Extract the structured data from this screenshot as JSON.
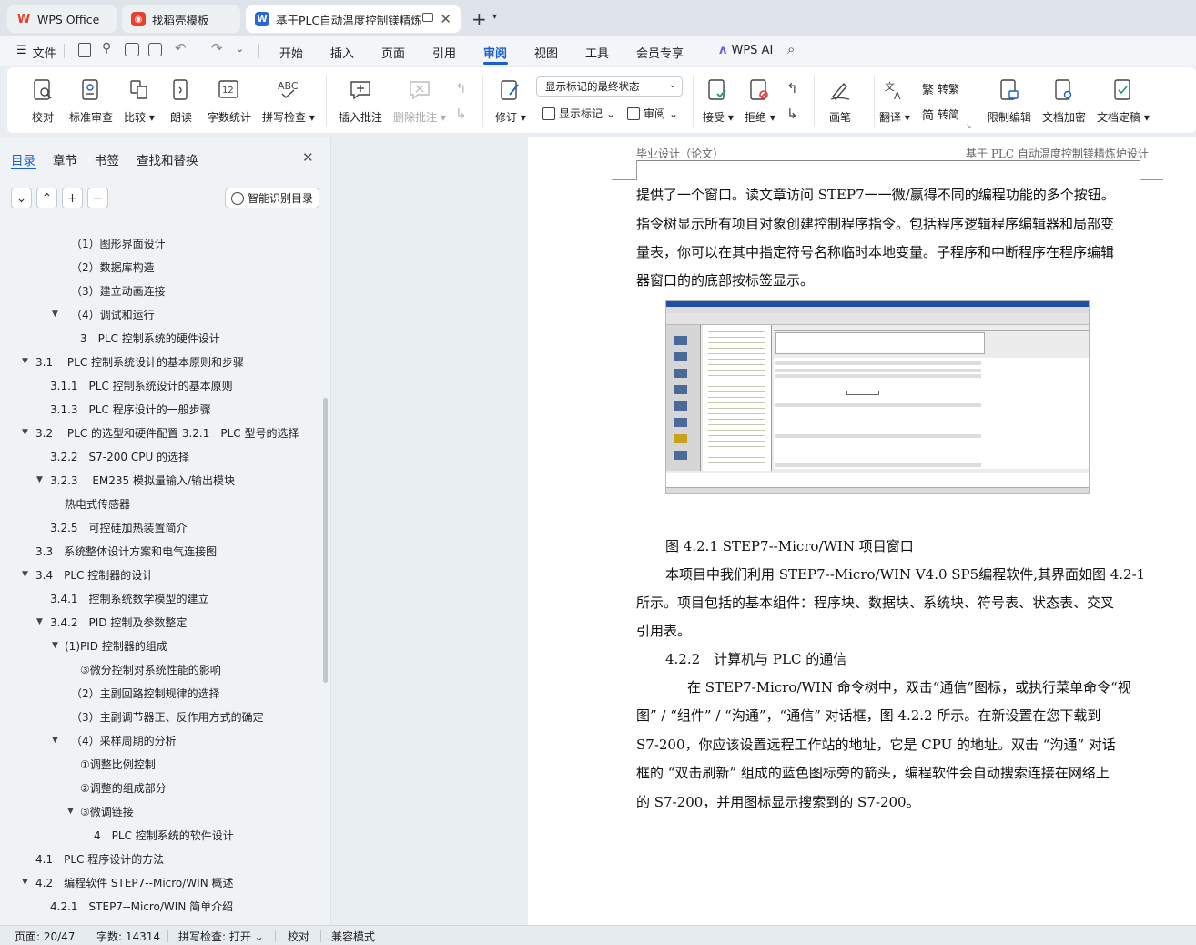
{
  "tabs": [
    {
      "label": "WPS Office",
      "logo": "W",
      "color": "#e8422f"
    },
    {
      "label": "找稻壳模板",
      "logo": "◉",
      "color": "#e8422f"
    },
    {
      "label": "基于PLC自动温度控制镁精炼",
      "logo": "W",
      "color": "#2b66d9"
    }
  ],
  "menu": {
    "file": "文件",
    "items": [
      "开始",
      "插入",
      "页面",
      "引用",
      "审阅",
      "视图",
      "工具",
      "会员专享"
    ],
    "selected": "审阅",
    "ai": "WPS AI"
  },
  "ribbon": {
    "proof": "校对",
    "std_review": "标准审查",
    "compare": "比较",
    "read_aloud": "朗读",
    "word_count": "字数统计",
    "spell": "拼写检查",
    "insert_comment": "插入批注",
    "delete_comment": "删除批注",
    "revise": "修订",
    "show_markup": "显示标记",
    "review": "审阅",
    "markup_select": "显示标记的最终状态",
    "accept": "接受",
    "reject": "拒绝",
    "pen": "画笔",
    "translate": "翻译",
    "to_trad": "转繁",
    "to_simp": "转简",
    "restrict": "限制编辑",
    "encrypt": "文档加密",
    "finalize": "文档定稿"
  },
  "sidebar": {
    "tabs": [
      "目录",
      "章节",
      "书签",
      "查找和替换"
    ],
    "smart": "智能识别目录",
    "toc": [
      {
        "t": "（1）图形界面设计"
      },
      {
        "t": "（2）数据库构造"
      },
      {
        "t": "（3）建立动画连接"
      },
      {
        "t": "（4）调试和运行"
      },
      {
        "t": "3　PLC 控制系统的硬件设计"
      },
      {
        "t": "3.1　 PLC 控制系统设计的基本原则和步骤"
      },
      {
        "t": "3.1.1　PLC 控制系统设计的基本原则"
      },
      {
        "t": "3.1.3　PLC 程序设计的一般步骤"
      },
      {
        "t": "3.2　 PLC 的选型和硬件配置 3.2.1　PLC 型号的选择"
      },
      {
        "t": "3.2.2　S7-200 CPU 的选择"
      },
      {
        "t": "3.2.3　 EM235  模拟量输入/输出模块"
      },
      {
        "t": "热电式传感器"
      },
      {
        "t": "3.2.5　可控硅加热装置简介"
      },
      {
        "t": "3.3　系统整体设计方案和电气连接图"
      },
      {
        "t": "3.4　PLC 控制器的设计"
      },
      {
        "t": "3.4.1　控制系统数学模型的建立"
      },
      {
        "t": "3.4.2　PID 控制及参数整定"
      },
      {
        "t": "(1)PID 控制器的组成"
      },
      {
        "t": "③微分控制对系统性能的影响"
      },
      {
        "t": "（2）主副回路控制规律的选择"
      },
      {
        "t": "（3）主副调节器正、反作用方式的确定"
      },
      {
        "t": "（4）采样周期的分析"
      },
      {
        "t": "①调整比例控制"
      },
      {
        "t": "②调整的组成部分"
      },
      {
        "t": "③微调链接"
      },
      {
        "t": "4　PLC 控制系统的软件设计"
      },
      {
        "t": "4.1　PLC 程序设计的方法"
      },
      {
        "t": "4.2　编程软件 STEP7--Micro/WIN  概述"
      },
      {
        "t": "4.2.1　STEP7--Micro/WIN  简单介绍"
      }
    ]
  },
  "doc": {
    "header_left": "毕业设计（论文）",
    "header_right": "基于 PLC 自动温度控制镁精炼炉设计",
    "lines": [
      "提供了一个窗口。读文章访问 STEP7一一微/赢得不同的编程功能的多个按钮。",
      "指令树显示所有项目对象创建控制程序指令。包括程序逻辑程序编辑器和局部变",
      "量表，你可以在其中指定符号名称临时本地变量。子程序和中断程序在程序编辑",
      "器窗口的的底部按标签显示。",
      "图  4.2.1 STEP7--Micro/WIN 项目窗口",
      "本项目中我们利用  STEP7--Micro/WIN V4.0 SP5编程软件,其界面如图 4.2-1",
      "所示。项目包括的基本组件：程序块、数据块、系统块、符号表、状态表、交叉",
      "引用表。",
      "4.2.2　计算机与 PLC 的通信",
      "在 STEP7-Micro/WIN 命令树中，双击“通信”图标，或执行菜单命令“视",
      "图” / “组件” / “沟通”，“通信” 对话框，图 4.2.2 所示。在新设置在您下载到",
      "S7-200，你应该设置远程工作站的地址，它是 CPU 的地址。双击 “沟通” 对话",
      "框的 “双击刷新” 组成的蓝色图标旁的箭头，编程软件会自动搜索连接在网络上",
      "的 S7-200，并用图标显示搜索到的 S7-200。"
    ]
  },
  "status": {
    "page": "页面: 20/47",
    "words": "字数: 14314",
    "spell": "拼写检查: 打开",
    "proof": "校对",
    "compat": "兼容模式"
  }
}
